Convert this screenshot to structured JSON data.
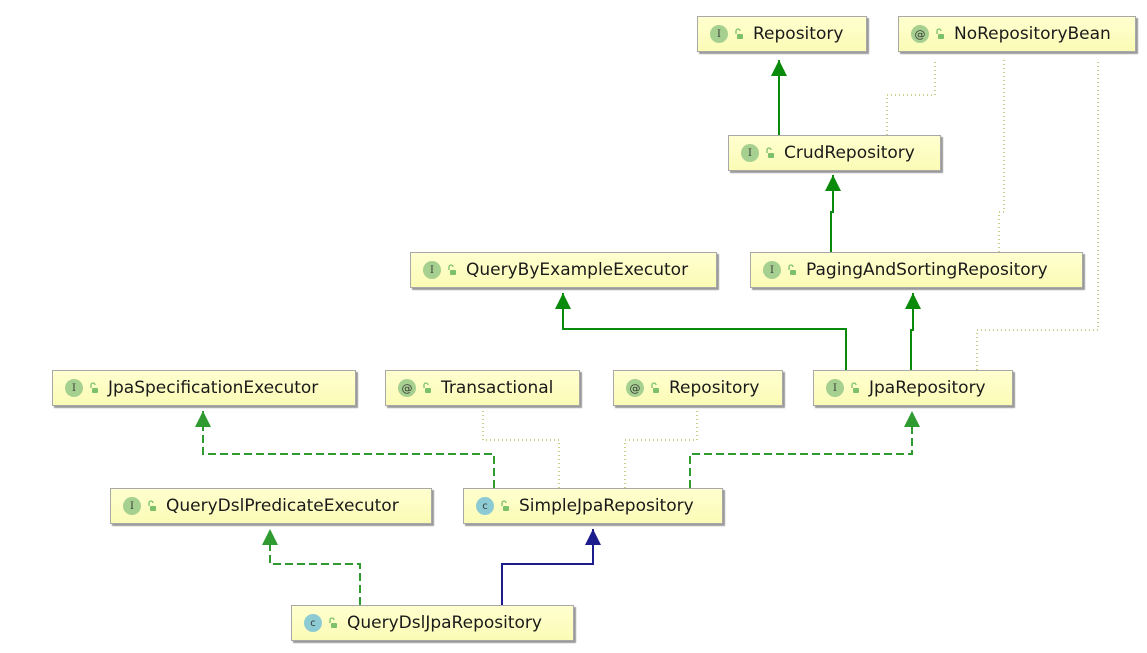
{
  "diagram": {
    "nodes": [
      {
        "id": "repository",
        "kind": "I",
        "label": "Repository"
      },
      {
        "id": "no-repository-bean",
        "kind": "@",
        "label": "NoRepositoryBean"
      },
      {
        "id": "crud-repository",
        "kind": "I",
        "label": "CrudRepository"
      },
      {
        "id": "query-by-example-executor",
        "kind": "I",
        "label": "QueryByExampleExecutor"
      },
      {
        "id": "paging-and-sorting-repository",
        "kind": "I",
        "label": "PagingAndSortingRepository"
      },
      {
        "id": "jpa-specification-executor",
        "kind": "I",
        "label": "JpaSpecificationExecutor"
      },
      {
        "id": "transactional",
        "kind": "@",
        "label": "Transactional"
      },
      {
        "id": "repository-annotation",
        "kind": "@",
        "label": "Repository"
      },
      {
        "id": "jpa-repository",
        "kind": "I",
        "label": "JpaRepository"
      },
      {
        "id": "query-dsl-predicate-executor",
        "kind": "I",
        "label": "QueryDslPredicateExecutor"
      },
      {
        "id": "simple-jpa-repository",
        "kind": "C",
        "label": "SimpleJpaRepository"
      },
      {
        "id": "query-dsl-jpa-repository",
        "kind": "C",
        "label": "QueryDslJpaRepository"
      }
    ],
    "edges": [
      {
        "from": "crud-repository",
        "to": "repository",
        "type": "extends"
      },
      {
        "from": "paging-and-sorting-repository",
        "to": "crud-repository",
        "type": "extends"
      },
      {
        "from": "jpa-repository",
        "to": "query-by-example-executor",
        "type": "extends"
      },
      {
        "from": "jpa-repository",
        "to": "paging-and-sorting-repository",
        "type": "extends"
      },
      {
        "from": "simple-jpa-repository",
        "to": "jpa-specification-executor",
        "type": "implements"
      },
      {
        "from": "simple-jpa-repository",
        "to": "jpa-repository",
        "type": "implements"
      },
      {
        "from": "query-dsl-jpa-repository",
        "to": "query-dsl-predicate-executor",
        "type": "implements"
      },
      {
        "from": "query-dsl-jpa-repository",
        "to": "simple-jpa-repository",
        "type": "class-extends"
      },
      {
        "from": "crud-repository",
        "to": "no-repository-bean",
        "type": "annotated"
      },
      {
        "from": "paging-and-sorting-repository",
        "to": "no-repository-bean",
        "type": "annotated"
      },
      {
        "from": "jpa-repository",
        "to": "no-repository-bean",
        "type": "annotated"
      },
      {
        "from": "simple-jpa-repository",
        "to": "transactional",
        "type": "annotated"
      },
      {
        "from": "simple-jpa-repository",
        "to": "repository-annotation",
        "type": "annotated"
      }
    ],
    "colors": {
      "interface_edge": "#0a8a0a",
      "implements_edge": "#2f9a2f",
      "class_edge": "#1c1c8c",
      "annotation_edge": "#b8c060",
      "interface_badge": "#a6d08f",
      "class_badge": "#8ccbd3",
      "lock_icon": "#7cc06a"
    }
  }
}
